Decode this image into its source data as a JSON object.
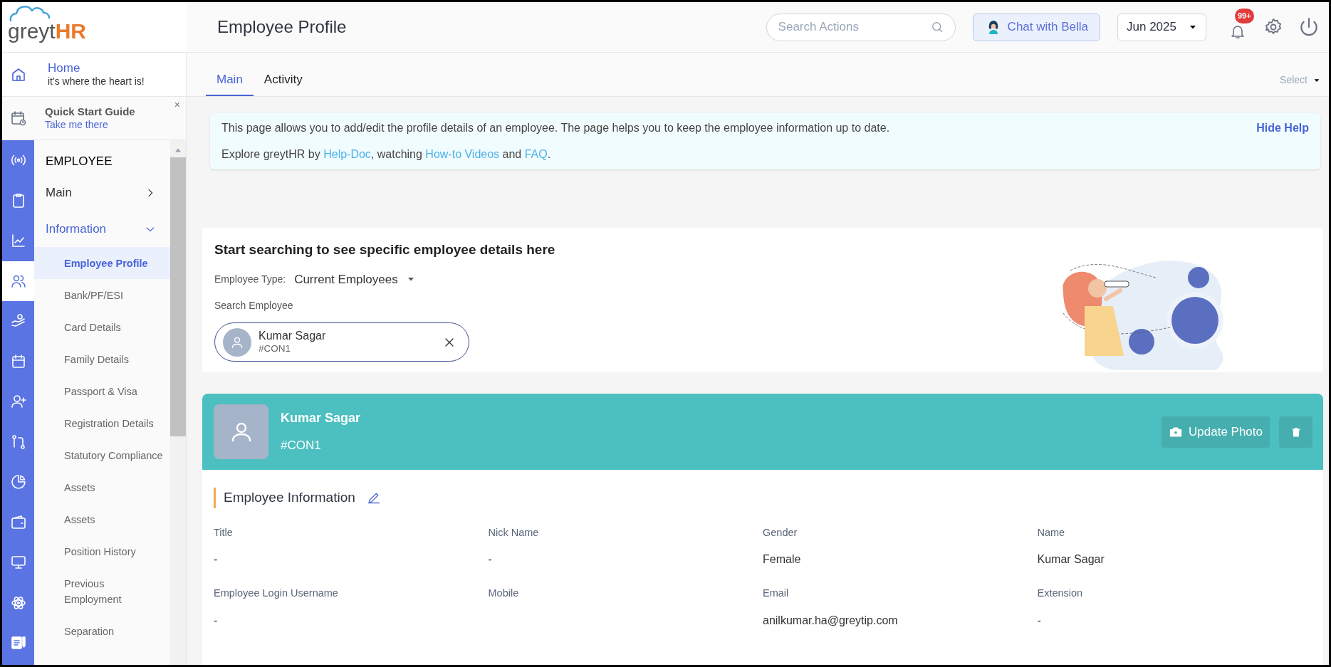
{
  "logo": {
    "text_a": "greyt",
    "text_b": "HR"
  },
  "header": {
    "title": "Employee Profile",
    "search": {
      "placeholder": "Search Actions"
    },
    "chat_button": "Chat with Bella",
    "period": "Jun 2025",
    "notifications": "99+"
  },
  "home": {
    "title": "Home",
    "subtitle": "it's where the heart is!"
  },
  "quick_start": {
    "title": "Quick Start Guide",
    "link": "Take me there",
    "close": "×"
  },
  "icon_rail": [
    {
      "kind": "broadcast",
      "selected": false
    },
    {
      "kind": "clipboard",
      "selected": false
    },
    {
      "kind": "chart",
      "selected": false
    },
    {
      "kind": "people",
      "selected": true
    },
    {
      "kind": "hand",
      "selected": false
    },
    {
      "kind": "calendar",
      "selected": false
    },
    {
      "kind": "user-plus",
      "selected": false
    },
    {
      "kind": "flow",
      "selected": false
    },
    {
      "kind": "pie",
      "selected": false
    },
    {
      "kind": "wallet",
      "selected": false
    },
    {
      "kind": "monitor",
      "selected": false
    },
    {
      "kind": "atom",
      "selected": false
    },
    {
      "kind": "document",
      "selected": false
    }
  ],
  "sidebar": {
    "heading": "EMPLOYEE",
    "groups": [
      {
        "label": "Main",
        "expanded": false
      },
      {
        "label": "Information",
        "expanded": true,
        "children": [
          {
            "label": "Employee Profile",
            "selected": true
          },
          {
            "label": "Bank/PF/ESI",
            "selected": false
          },
          {
            "label": "Card Details",
            "selected": false
          },
          {
            "label": "Family Details",
            "selected": false
          },
          {
            "label": "Passport & Visa",
            "selected": false
          },
          {
            "label": "Registration Details",
            "selected": false
          },
          {
            "label": "Statutory Compliance",
            "selected": false
          },
          {
            "label": "Assets",
            "selected": false
          },
          {
            "label": "Assets",
            "selected": false
          },
          {
            "label": "Position History",
            "selected": false
          },
          {
            "label": "Previous Employment",
            "selected": false
          },
          {
            "label": "Separation",
            "selected": false
          }
        ]
      }
    ]
  },
  "tabs": [
    {
      "label": "Main",
      "selected": true
    },
    {
      "label": "Activity",
      "selected": false
    }
  ],
  "select": "Select",
  "help": {
    "text": "This page allows you to add/edit the profile details of an employee. The page helps you to keep the employee information up to date.",
    "hide": "Hide Help",
    "explore": [
      {
        "text": "Explore greytHR by ",
        "link": false
      },
      {
        "text": "Help-Doc",
        "link": true
      },
      {
        "text": ", watching ",
        "link": false
      },
      {
        "text": "How-to Videos",
        "link": true
      },
      {
        "text": " and ",
        "link": false
      },
      {
        "text": "FAQ",
        "link": true
      },
      {
        "text": ".",
        "link": false
      }
    ]
  },
  "search_card": {
    "title": "Start searching to see specific employee details here",
    "type_label": "Employee Type:",
    "type_value": "Current Employees",
    "search_label": "Search Employee",
    "selected_employee": {
      "name": "Kumar Sagar",
      "id": "#CON1"
    }
  },
  "profile": {
    "name": "Kumar Sagar",
    "id": "#CON1",
    "update_photo": "Update Photo"
  },
  "employee_information": {
    "title": "Employee Information",
    "fields": [
      {
        "label": "Title",
        "value": "-"
      },
      {
        "label": "Nick Name",
        "value": "-"
      },
      {
        "label": "Gender",
        "value": "Female"
      },
      {
        "label": "Name",
        "value": "Kumar Sagar"
      },
      {
        "label": "Employee Login Username",
        "value": "-"
      },
      {
        "label": "Mobile"
      },
      {
        "label": "Email",
        "value": "anilkumar.ha@greytip.com"
      },
      {
        "label": "Extension",
        "value": "-"
      }
    ]
  }
}
